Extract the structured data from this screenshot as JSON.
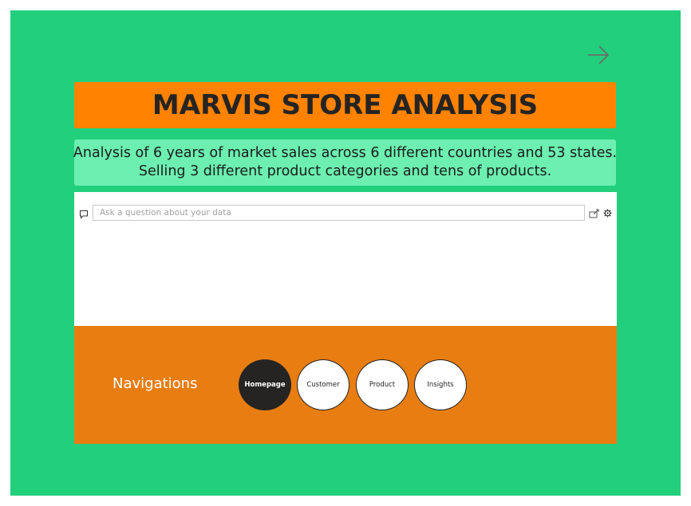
{
  "report": {
    "title": "MARVIS STORE ANALYSIS",
    "description_line1": "Analysis of 6 years of market sales across 6 different countries and 53 states.",
    "description_line2": "Selling 3 different product categories and tens of products."
  },
  "qa": {
    "placeholder": "Ask a question about your data",
    "icons": [
      "speech-bubble-icon",
      "share-icon",
      "gear-icon"
    ]
  },
  "navigation": {
    "label": "Navigations",
    "buttons": [
      {
        "label": "Homepage",
        "active": true
      },
      {
        "label": "Customer",
        "active": false
      },
      {
        "label": "Product",
        "active": false
      },
      {
        "label": "Insights",
        "active": false
      }
    ]
  },
  "icons": {
    "next": "arrow-right-icon"
  },
  "colors": {
    "background": "#22cf7c",
    "title_bar": "#ff8200",
    "description_box": "#6cefb0",
    "nav_panel": "#e87d12",
    "active_button": "#252423"
  }
}
